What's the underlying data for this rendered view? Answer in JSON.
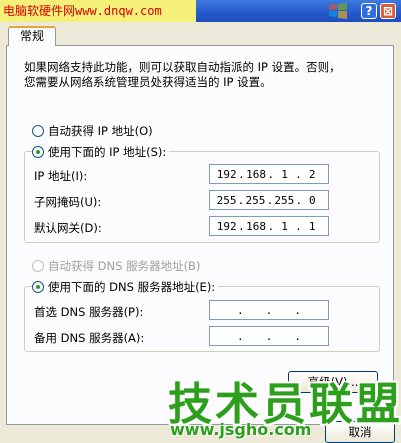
{
  "watermark_top": "电脑软硬件网www.dnqw.com",
  "title_controls": {
    "help": "?",
    "close": "⊠"
  },
  "tab": {
    "label": "常规"
  },
  "description": {
    "line1": "如果网络支持此功能，则可以获取自动指派的 IP 设置。否则，",
    "line2": "您需要从网络系统管理员处获得适当的 IP 设置。"
  },
  "ip_mode": {
    "auto_label": "自动获得 IP 地址(O)",
    "manual_label": "使用下面的 IP 地址(S):",
    "selected": "manual"
  },
  "ip_fields": [
    {
      "label": "IP 地址(I):",
      "octets": [
        "192",
        "168",
        "1",
        "2"
      ]
    },
    {
      "label": "子网掩码(U):",
      "octets": [
        "255",
        "255",
        "255",
        "0"
      ]
    },
    {
      "label": "默认网关(D):",
      "octets": [
        "192",
        "168",
        "1",
        "1"
      ]
    }
  ],
  "dns_mode": {
    "auto_label": "自动获得 DNS 服务器地址(B)",
    "manual_label": "使用下面的 DNS 服务器地址(E):",
    "selected": "manual"
  },
  "dns_fields": [
    {
      "label": "首选 DNS 服务器(P):",
      "octets": [
        "",
        "",
        "",
        ""
      ]
    },
    {
      "label": "备用 DNS 服务器(A):",
      "octets": [
        "",
        "",
        "",
        ""
      ]
    }
  ],
  "buttons": {
    "advanced": "高级(V)...",
    "cancel": "取消"
  },
  "watermark_overlay": {
    "text": "技术员联盟",
    "url": "www.jsgho.com"
  }
}
